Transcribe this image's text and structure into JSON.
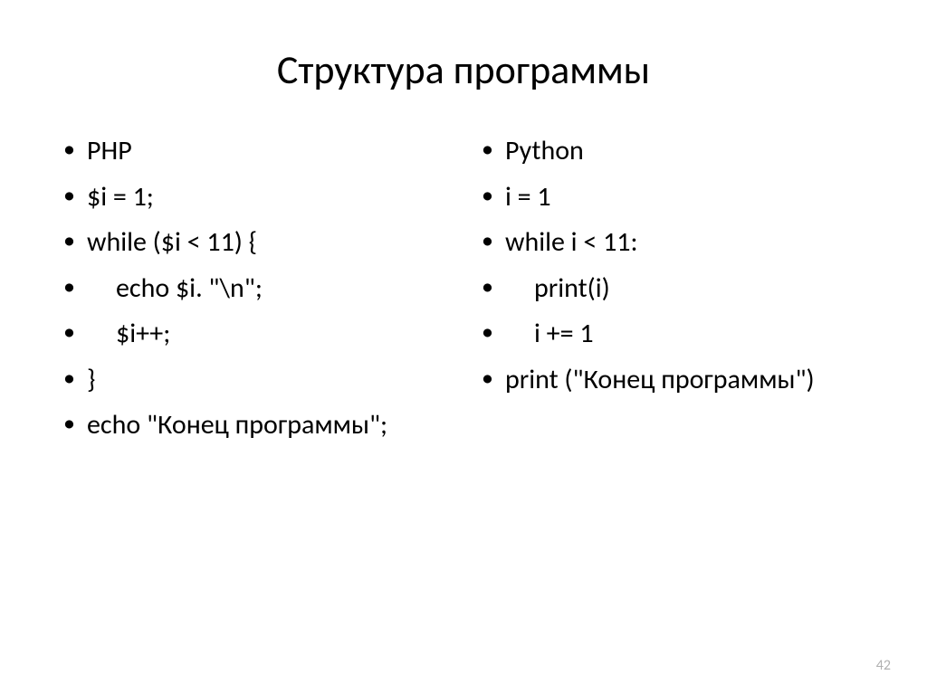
{
  "slide": {
    "title": "Структура программы",
    "pageNumber": "42",
    "leftColumn": {
      "items": [
        {
          "text": "PHP",
          "indent": false
        },
        {
          "text": "$i = 1;",
          "indent": false
        },
        {
          "text": "while ($i < 11) {",
          "indent": false
        },
        {
          "text": "echo $i. \"\\n\";",
          "indent": true
        },
        {
          "text": "$i++;",
          "indent": true
        },
        {
          "text": "}",
          "indent": false
        },
        {
          "text": "echo \"Конец программы\";",
          "indent": false
        }
      ]
    },
    "rightColumn": {
      "items": [
        {
          "text": "Python",
          "indent": false
        },
        {
          "text": "i = 1",
          "indent": false
        },
        {
          "text": "while i < 11:",
          "indent": false
        },
        {
          "text": "print(i)",
          "indent": true
        },
        {
          "text": "i  +=  1",
          "indent": true
        },
        {
          "text": "print (\"Конец программы\")",
          "indent": false
        }
      ]
    }
  }
}
